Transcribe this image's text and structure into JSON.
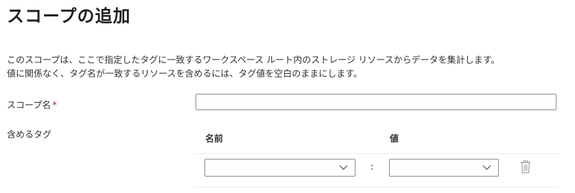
{
  "page": {
    "title": "スコープの追加",
    "description_line1": "このスコープは、ここで指定したタグに一致するワークスペース ルート内のストレージ リソースからデータを集計します。",
    "description_line2": "値に関係なく、タグ名が一致するリソースを含めるには、タグ値を空白のままにします。"
  },
  "form": {
    "scope_name_label": "スコープ名",
    "required_marker": "*",
    "scope_name_value": "",
    "include_tags_label": "含めるタグ"
  },
  "tags": {
    "columns": {
      "name": "名前",
      "value": "値"
    },
    "separator": ":",
    "rows": [
      {
        "name": "",
        "value": ""
      }
    ]
  },
  "icons": {
    "dropdown": "chevron-down-icon",
    "delete": "trash-icon"
  },
  "colors": {
    "required": "#a4262c",
    "border": "#8a8886",
    "divider": "#edebe9",
    "icon_gray": "#a19f9d"
  }
}
